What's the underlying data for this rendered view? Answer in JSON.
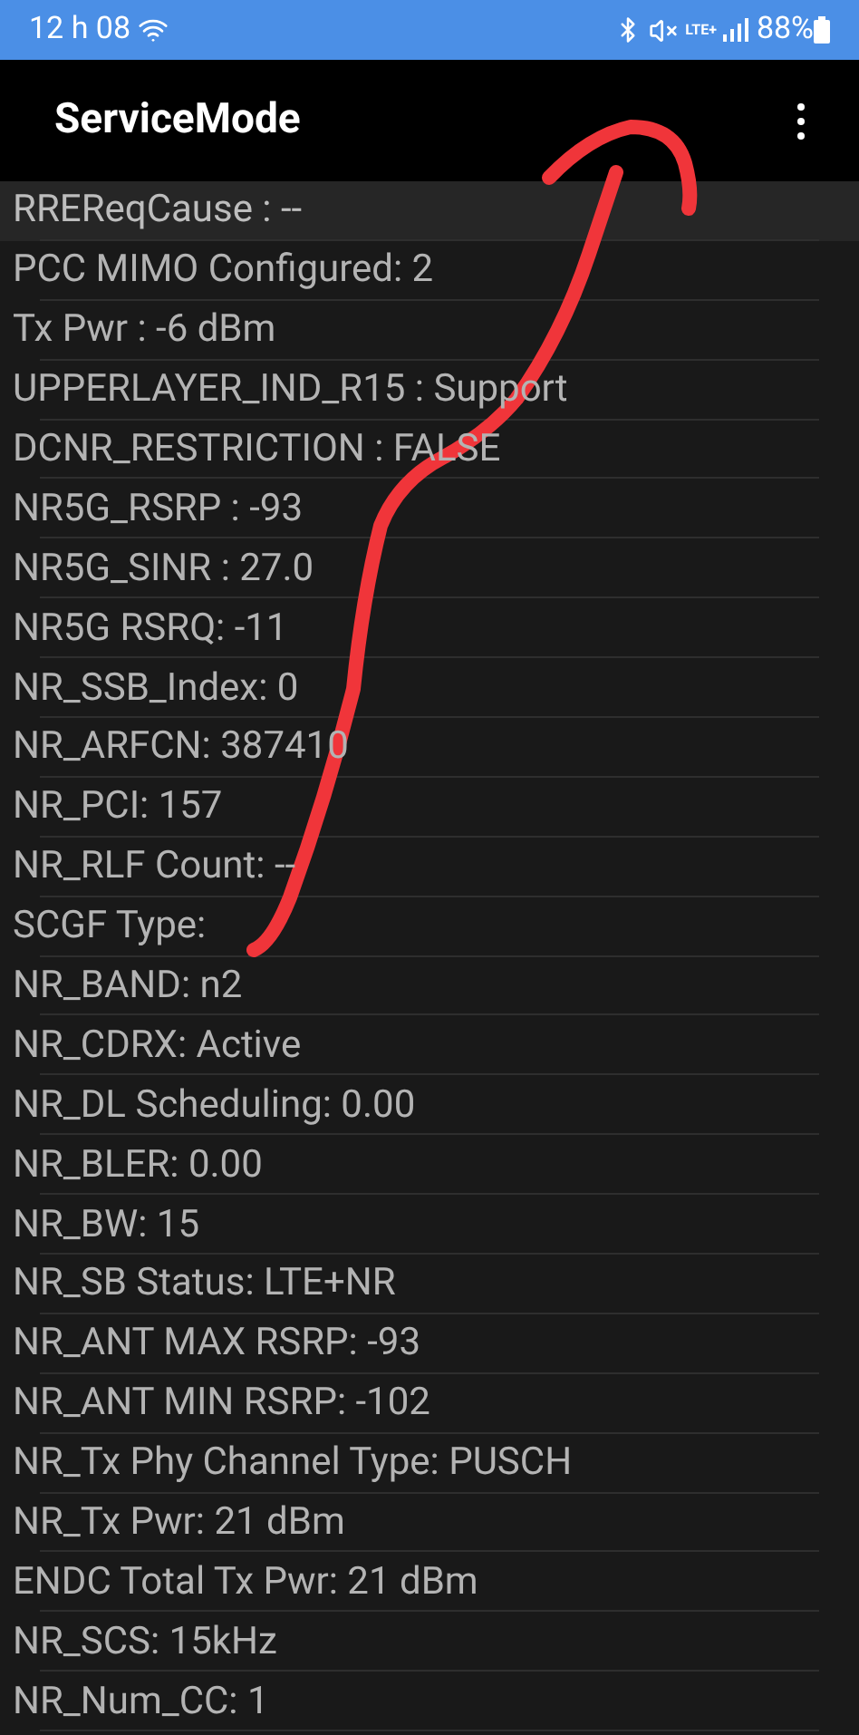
{
  "status_bar": {
    "time": "12 h 08",
    "network": "LTE+",
    "battery": "88%"
  },
  "app_bar": {
    "title": "ServiceMode"
  },
  "rows": [
    {
      "text": "RREReqCause : --",
      "highlighted": true
    },
    {
      "text": "PCC MIMO Configured: 2",
      "highlighted": false
    },
    {
      "text": "Tx Pwr : -6 dBm",
      "highlighted": false
    },
    {
      "text": "UPPERLAYER_IND_R15 : Support",
      "highlighted": false
    },
    {
      "text": "DCNR_RESTRICTION : FALSE",
      "highlighted": false
    },
    {
      "text": "NR5G_RSRP : -93",
      "highlighted": false
    },
    {
      "text": "NR5G_SINR : 27.0",
      "highlighted": false
    },
    {
      "text": "NR5G RSRQ: -11",
      "highlighted": false
    },
    {
      "text": "NR_SSB_Index: 0",
      "highlighted": false
    },
    {
      "text": "NR_ARFCN: 387410",
      "highlighted": false
    },
    {
      "text": "NR_PCI: 157",
      "highlighted": false
    },
    {
      "text": "NR_RLF Count: --",
      "highlighted": false
    },
    {
      "text": "SCGF Type:",
      "highlighted": false
    },
    {
      "text": "NR_BAND: n2",
      "highlighted": false
    },
    {
      "text": "NR_CDRX: Active",
      "highlighted": false
    },
    {
      "text": "NR_DL Scheduling: 0.00",
      "highlighted": false
    },
    {
      "text": "NR_BLER: 0.00",
      "highlighted": false
    },
    {
      "text": "NR_BW: 15",
      "highlighted": false
    },
    {
      "text": "NR_SB Status: LTE+NR",
      "highlighted": false
    },
    {
      "text": "NR_ANT MAX RSRP: -93",
      "highlighted": false
    },
    {
      "text": "NR_ANT MIN RSRP: -102",
      "highlighted": false
    },
    {
      "text": "NR_Tx Phy Channel Type: PUSCH",
      "highlighted": false
    },
    {
      "text": "NR_Tx Pwr: 21 dBm",
      "highlighted": false
    },
    {
      "text": "ENDC Total Tx Pwr: 21 dBm",
      "highlighted": false
    },
    {
      "text": "NR_SCS: 15kHz",
      "highlighted": false
    },
    {
      "text": "NR_Num_CC: 1",
      "highlighted": false
    }
  ]
}
